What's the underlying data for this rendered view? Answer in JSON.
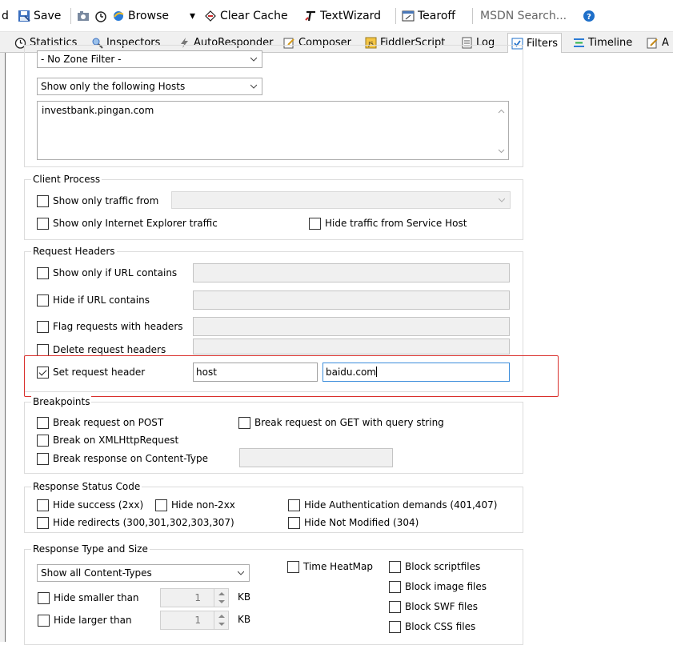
{
  "toolbar": {
    "partial_label": "d",
    "save": "Save",
    "browse": "Browse",
    "clear_cache": "Clear Cache",
    "text_wizard": "TextWizard",
    "tearoff": "Tearoff",
    "msdn_search": "MSDN Search..."
  },
  "tabs": [
    {
      "label": "Statistics",
      "icon": "stopwatch-icon"
    },
    {
      "label": "Inspectors",
      "icon": "inspectors-icon"
    },
    {
      "label": "AutoResponder",
      "icon": "lightning-icon"
    },
    {
      "label": "Composer",
      "icon": "composer-icon"
    },
    {
      "label": "FiddlerScript",
      "icon": "script-icon"
    },
    {
      "label": "Log",
      "icon": "log-icon"
    },
    {
      "label": "Filters",
      "icon": "checkbox-icon",
      "active": true
    },
    {
      "label": "Timeline",
      "icon": "timeline-icon"
    },
    {
      "label": "A",
      "icon": "pencil-icon"
    }
  ],
  "hosts": {
    "zone_filter": "- No Zone Filter -",
    "host_filter": "Show only the following Hosts",
    "host_list": "investbank.pingan.com"
  },
  "client_process": {
    "title": "Client Process",
    "show_only_traffic_from": "Show only traffic from",
    "show_only_ie": "Show only Internet Explorer traffic",
    "hide_service_host": "Hide traffic from Service Host"
  },
  "request_headers": {
    "title": "Request Headers",
    "url_contains": "Show only if URL contains",
    "hide_url_contains": "Hide if URL contains",
    "flag_requests": "Flag requests with headers",
    "delete_headers": "Delete request headers",
    "set_header": "Set request header",
    "set_header_checked": true,
    "header_name": "host",
    "header_value": "baidu.com"
  },
  "breakpoints": {
    "title": "Breakpoints",
    "break_post": "Break request on POST",
    "break_get": "Break request on GET with query string",
    "break_xhr": "Break on XMLHttpRequest",
    "break_content_type": "Break response on Content-Type"
  },
  "response_status": {
    "title": "Response Status Code",
    "hide_success": "Hide success (2xx)",
    "hide_non2xx": "Hide non-2xx",
    "hide_auth": "Hide Authentication demands (401,407)",
    "hide_redirects": "Hide redirects (300,301,302,303,307)",
    "hide_not_modified": "Hide Not Modified (304)"
  },
  "response_type": {
    "title": "Response Type and Size",
    "content_type_select": "Show all Content-Types",
    "time_heatmap": "Time HeatMap",
    "block_script": "Block scriptfiles",
    "block_image": "Block image files",
    "block_swf": "Block SWF files",
    "block_css": "Block CSS files",
    "hide_smaller": "Hide smaller than",
    "hide_larger": "Hide larger than",
    "smaller_value": "1",
    "larger_value": "1",
    "unit": "KB"
  },
  "colors": {
    "highlight": "#d9302c",
    "focus": "#3c8ddb",
    "accent_blue": "#1e6fc9"
  }
}
